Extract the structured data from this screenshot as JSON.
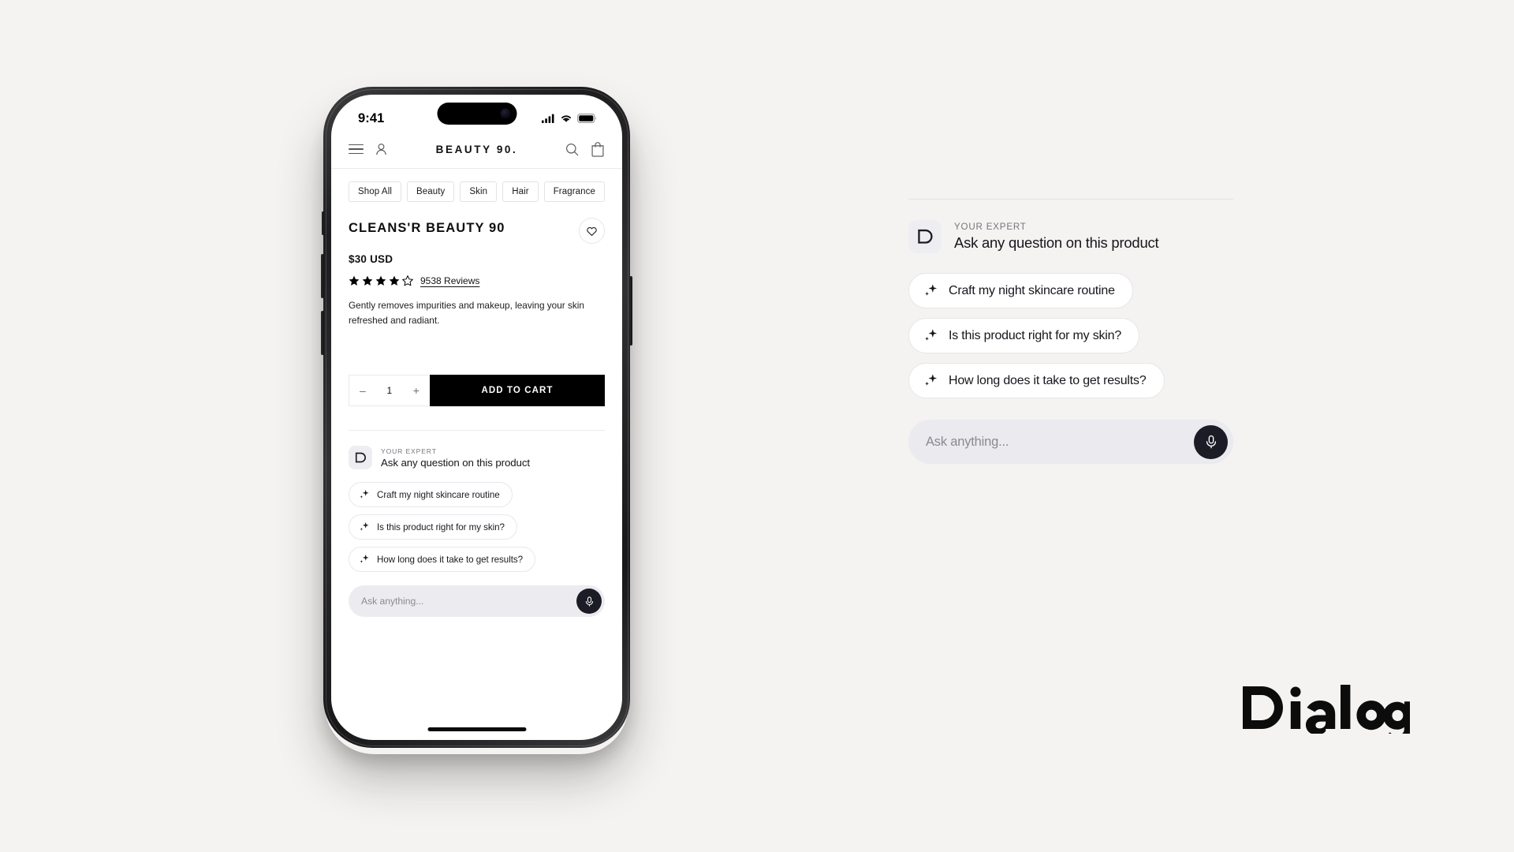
{
  "page": {
    "background_color": "#f4f3f1",
    "brand_wordmark": "Dialog"
  },
  "phone": {
    "status_bar": {
      "time": "9:41",
      "icons": [
        "cellular-signal-icon",
        "wifi-icon",
        "battery-icon"
      ]
    },
    "store_header": {
      "brand": "BEAUTY 90.",
      "left_icons": [
        "menu-icon",
        "account-icon"
      ],
      "right_icons": [
        "search-icon",
        "shopping-bag-icon"
      ]
    },
    "categories": [
      "Shop All",
      "Beauty",
      "Skin",
      "Hair",
      "Fragrance"
    ],
    "product": {
      "title": "CLEANS'R BEAUTY 90",
      "price": "$30 USD",
      "rating_value": 4.5,
      "stars_filled": 4,
      "stars_half": 1,
      "stars_total": 5,
      "reviews_label": "9538 Reviews",
      "description": "Gently removes impurities and makeup, leaving your skin refreshed and radiant.",
      "wishlist_icon": "heart-icon"
    },
    "cart": {
      "quantity": "1",
      "decrement_label": "–",
      "increment_label": "+",
      "add_to_cart_label": "ADD TO CART"
    },
    "expert": {
      "avatar_letter": "D",
      "eyebrow": "YOUR EXPERT",
      "headline": "Ask any question on this product",
      "suggestions": [
        "Craft my night skincare routine",
        "Is this product right for my skin?",
        "How long does it take to get results?"
      ],
      "input_placeholder": "Ask anything...",
      "mic_icon": "microphone-icon",
      "chip_icon": "sparkle-icon"
    }
  },
  "panel": {
    "avatar_letter": "D",
    "eyebrow": "YOUR EXPERT",
    "headline": "Ask any question on this product",
    "suggestions": [
      "Craft my night skincare routine",
      "Is this product right for my skin?",
      "How long does it take to get results?"
    ],
    "input_placeholder": "Ask anything...",
    "mic_icon": "microphone-icon",
    "chip_icon": "sparkle-icon"
  },
  "colors": {
    "background": "#f4f3f1",
    "ink": "#16161c",
    "muted": "#76767f",
    "chip_border": "#e7e6eb",
    "input_fill": "#eaeaef",
    "accent_dark": "#1c1c26"
  }
}
